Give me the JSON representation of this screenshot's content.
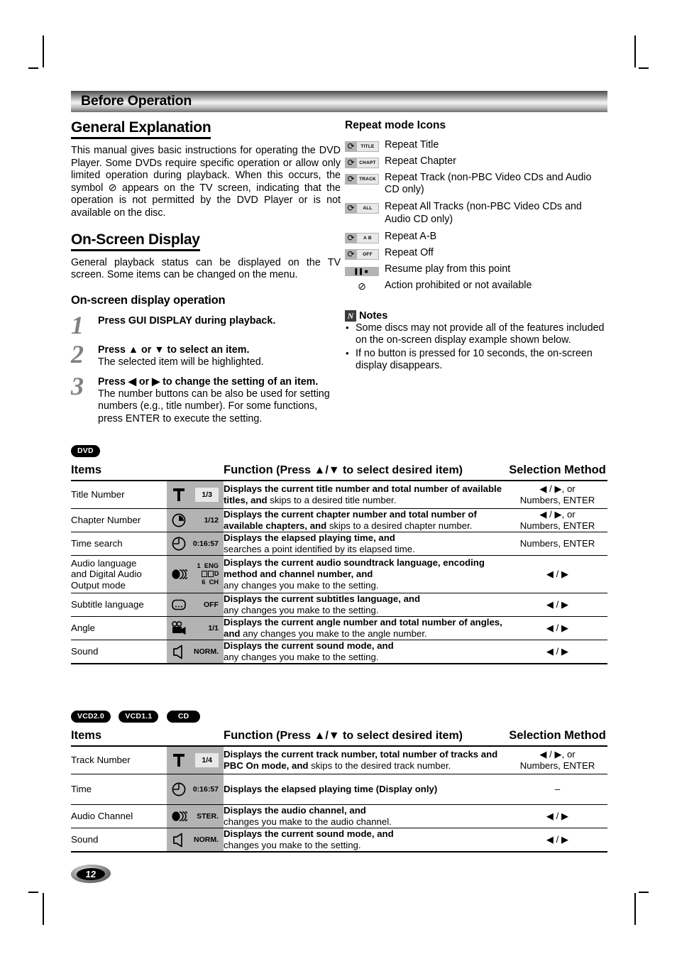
{
  "header": {
    "title": "Before Operation"
  },
  "left": {
    "general": {
      "heading": "General Explanation",
      "body": "This manual gives basic instructions for operating the DVD Player. Some DVDs require specific operation or allow only limited operation during playback. When this occurs, the symbol ⊘ appears on the TV screen, indicating that the operation is not permitted by the DVD Player or is not available on the disc."
    },
    "osd": {
      "heading": "On-Screen Display",
      "body": "General playback status can be displayed on the TV screen. Some items can be changed on the menu.",
      "sub_heading": "On-screen display operation",
      "steps": [
        {
          "num": "1",
          "line1": "Press GUI DISPLAY during playback.",
          "line2": ""
        },
        {
          "num": "2",
          "line1": "Press ▲ or ▼ to select an item.",
          "line2": "The selected item will be highlighted."
        },
        {
          "num": "3",
          "line1": "Press ◀ or ▶ to change the setting of an item.",
          "line2": "The number buttons can be also be used for setting numbers (e.g., title number). For some functions, press ENTER to execute the setting."
        }
      ]
    }
  },
  "right": {
    "repeat": {
      "heading": "Repeat mode Icons",
      "items": [
        {
          "icon": "repeat-title-icon",
          "badge": "TITLE",
          "label": "Repeat Title"
        },
        {
          "icon": "repeat-chapter-icon",
          "badge": "CHAPT",
          "label": "Repeat Chapter"
        },
        {
          "icon": "repeat-track-icon",
          "badge": "TRACK",
          "label": "Repeat Track (non-PBC Video CDs and Audio CD only)"
        },
        {
          "icon": "repeat-all-icon",
          "badge": "ALL",
          "label": "Repeat All Tracks (non-PBC Video CDs  and Audio CD only)"
        },
        {
          "icon": "repeat-ab-icon",
          "badge": "A  B",
          "label": "Repeat A-B"
        },
        {
          "icon": "repeat-off-icon",
          "badge": "OFF",
          "label": "Repeat Off"
        },
        {
          "icon": "resume-icon",
          "badge": "RESUME",
          "label": "Resume play from this point"
        },
        {
          "icon": "prohibited-icon",
          "badge": "",
          "label": "Action prohibited or not available"
        }
      ]
    },
    "notes": {
      "title": "Notes",
      "badge": "N",
      "items": [
        "Some discs may not provide all of the features included on the on-screen display example shown below.",
        "If no button is pressed for 10 seconds, the on-screen display disappears."
      ]
    }
  },
  "tables": [
    {
      "badges": [
        "DVD"
      ],
      "columns": {
        "items": "Items",
        "function": "Function",
        "function_note": "(Press ▲/▼ to select desired item)",
        "selection": "Selection Method"
      },
      "rows": [
        {
          "item": "Title Number",
          "icon": "title-osd-icon",
          "value": "1/3",
          "value_style": "box",
          "func_bold": "Displays the current title number and total number of available titles, and",
          "func_plain": " skips to a desired title number.",
          "selection": "◀ / ▶, or\nNumbers, ENTER"
        },
        {
          "item": "Chapter Number",
          "icon": "chapter-osd-icon",
          "value": "1/12",
          "value_style": "plain",
          "func_bold": "Displays the current chapter number and total number of available chapters, and",
          "func_plain": " skips to a desired chapter number.",
          "selection": "◀ / ▶, or\nNumbers, ENTER"
        },
        {
          "item": "Time search",
          "icon": "clock-osd-icon",
          "value": "0:16:57",
          "value_style": "plain",
          "func_bold": "Displays the elapsed playing time, and",
          "func_plain": "searches a point identified by its elapsed time.",
          "func_break": true,
          "selection": "Numbers, ENTER"
        },
        {
          "item": "Audio language\nand Digital Audio\nOutput mode",
          "icon": "audio-osd-icon",
          "value": "1  ENG\n□□D\n6  CH",
          "value_style": "multi",
          "func_bold": "Displays the current audio soundtrack language, encoding method and channel number, and",
          "func_plain": "any changes you make to the setting.",
          "func_break": true,
          "selection": "◀ / ▶"
        },
        {
          "item": "Subtitle language",
          "icon": "subtitle-osd-icon",
          "value": "OFF",
          "value_style": "plain",
          "func_bold": "Displays the current subtitles language, and",
          "func_plain": "any changes you make to the setting.",
          "func_break": true,
          "selection": "◀ / ▶"
        },
        {
          "item": "Angle",
          "icon": "angle-osd-icon",
          "value": "1/1",
          "value_style": "plain",
          "func_bold": "Displays the current angle number and total number of angles, and",
          "func_plain": " any changes you make to the angle number.",
          "selection": "◀ / ▶"
        },
        {
          "item": "Sound",
          "icon": "sound-osd-icon",
          "value": "NORM.",
          "value_style": "plain",
          "func_bold": "Displays the current sound mode, and",
          "func_plain": "any changes you make to the setting.",
          "func_break": true,
          "selection": "◀ / ▶"
        }
      ]
    },
    {
      "badges": [
        "VCD2.0",
        "VCD1.1",
        "CD"
      ],
      "columns": {
        "items": "Items",
        "function": "Function",
        "function_note": "(Press ▲/▼ to select desired item)",
        "selection": "Selection Method"
      },
      "rows": [
        {
          "item": "Track Number",
          "icon": "title-osd-icon",
          "value": "1/4",
          "value_style": "box",
          "func_bold": "Displays the current track number, total number of tracks and PBC On mode, and",
          "func_plain": " skips to the desired track number.",
          "selection": "◀ / ▶, or\nNumbers, ENTER"
        },
        {
          "item": "Time",
          "icon": "clock-osd-icon",
          "value": "0:16:57",
          "value_style": "plain",
          "func_bold": "Displays the elapsed playing time (Display only)",
          "func_plain": "",
          "selection": "–"
        },
        {
          "item": "Audio Channel",
          "icon": "audio-ch-osd-icon",
          "value": "STER.",
          "value_style": "plain",
          "func_bold": "Displays the audio channel, and",
          "func_plain": "changes you make to the audio channel.",
          "func_break": true,
          "selection": "◀ / ▶"
        },
        {
          "item": "Sound",
          "icon": "sound-osd-icon",
          "value": "NORM.",
          "value_style": "plain",
          "func_bold": "Displays the current sound mode, and",
          "func_plain": "changes you make to the setting.",
          "func_break": true,
          "selection": "◀ / ▶"
        }
      ]
    }
  ],
  "page_number": "12"
}
